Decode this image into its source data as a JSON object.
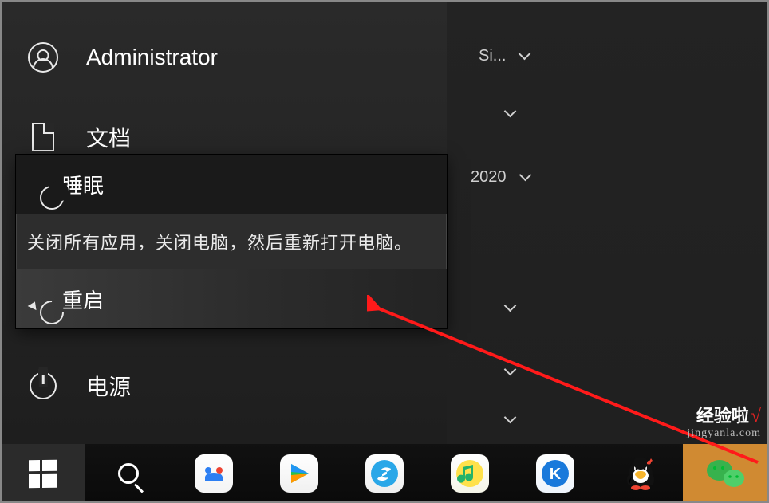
{
  "start_menu": {
    "user_label": "Administrator",
    "documents_label": "文档",
    "power_label": "电源",
    "popup": {
      "sleep_label": "睡眠",
      "restart_label": "重启",
      "restart_tooltip": "关闭所有应用，关闭电脑，然后重新打开电脑。"
    }
  },
  "bg_panel": {
    "row1_text": "Si...",
    "row2_text": "2020"
  },
  "watermark": {
    "brand": "经验啦",
    "url": "jingyanla.com"
  },
  "taskbar": {
    "apps": [
      "start",
      "search",
      "baidu-netdisk",
      "tencent-video",
      "sogou-browser",
      "qq-music",
      "kugou-music",
      "qq",
      "wechat"
    ]
  }
}
